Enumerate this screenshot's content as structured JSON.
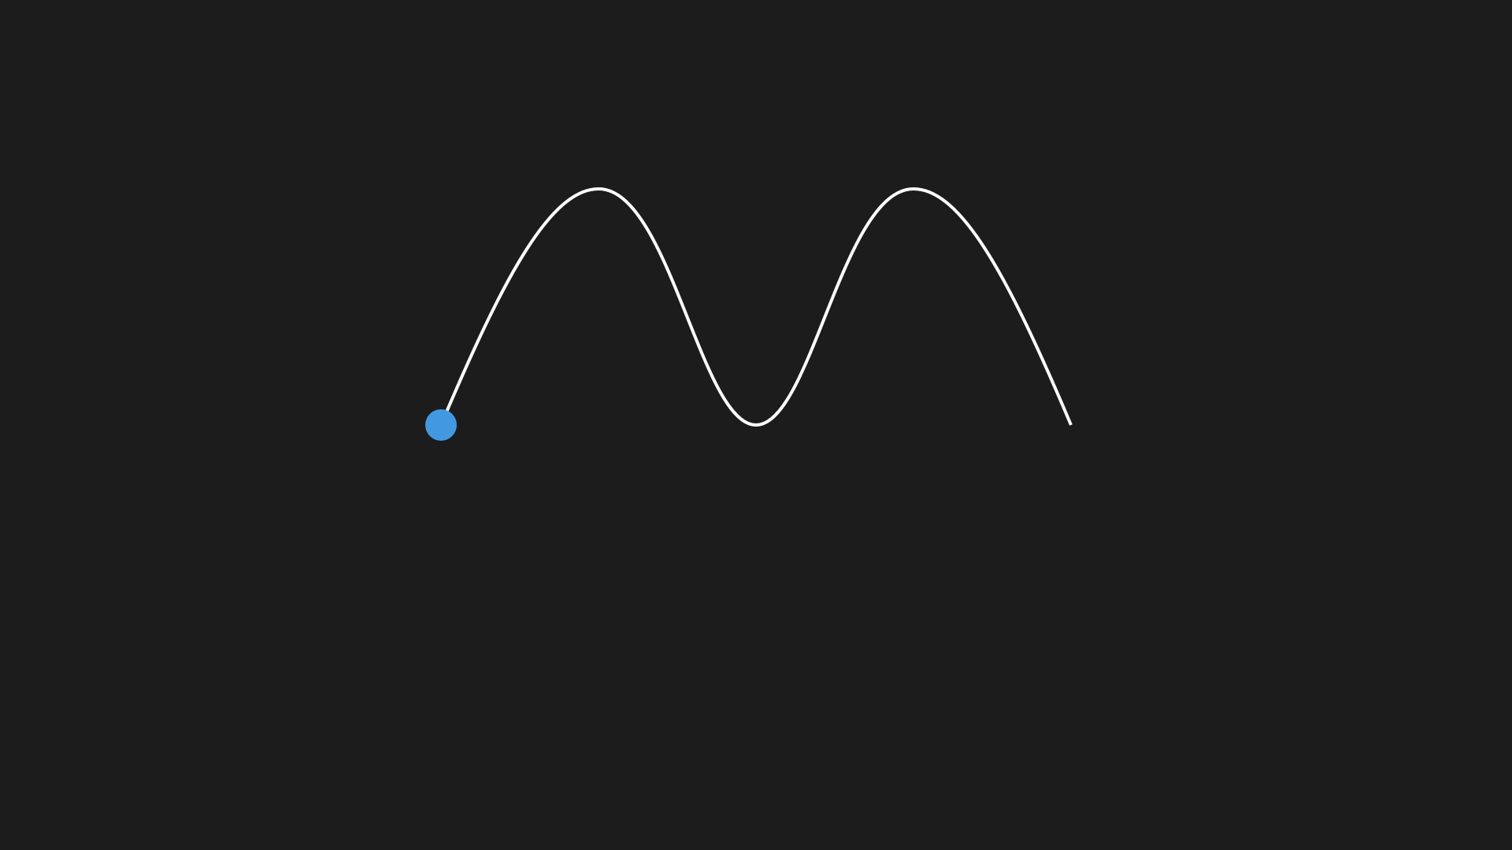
{
  "scene": {
    "background_color": "#1c1c1c",
    "path_color": "#ffffff",
    "marker_color": "#4299e1",
    "path_shape": "wave with two peaks and one trough",
    "marker_position": "start of path"
  }
}
